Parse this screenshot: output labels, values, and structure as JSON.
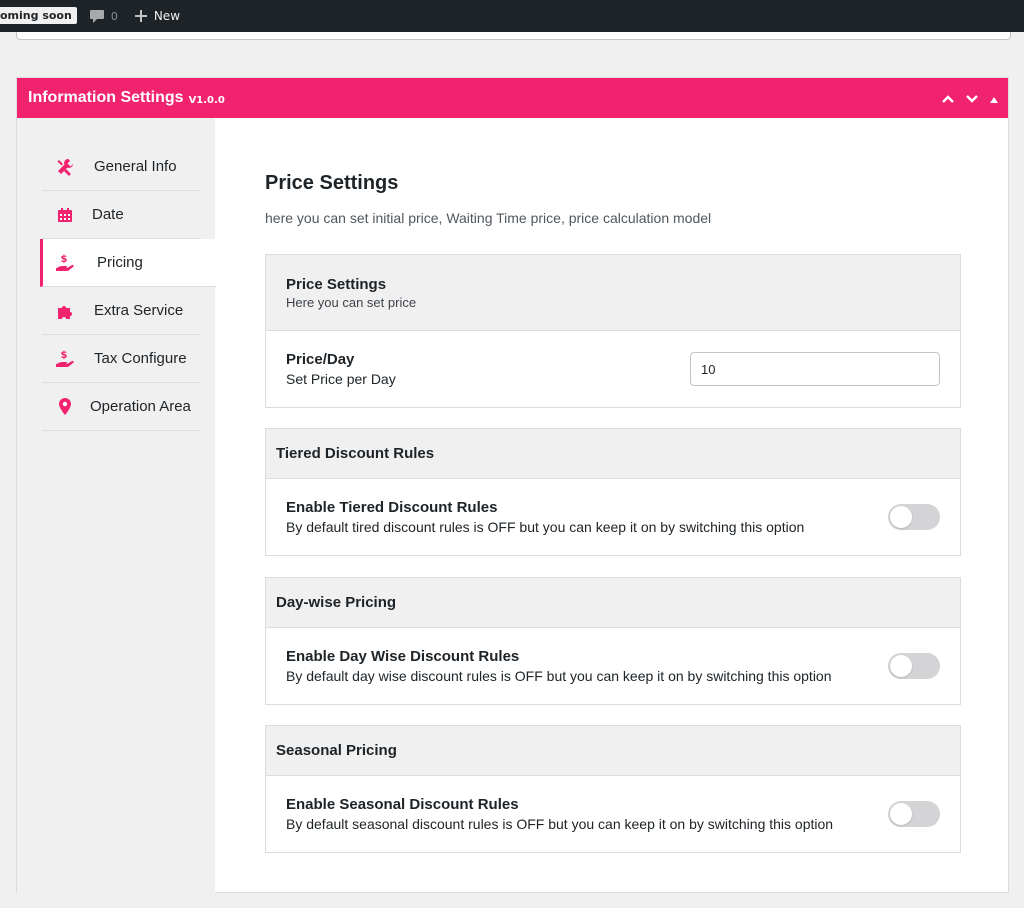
{
  "adminbar": {
    "site_label": "oming soon",
    "comments_count": "0",
    "new_label": "New"
  },
  "panel": {
    "title": "Information Settings",
    "version": "V1.0.0"
  },
  "sidebar": {
    "items": [
      {
        "label": "General Info",
        "icon": "tools-icon"
      },
      {
        "label": "Date",
        "icon": "calendar-icon"
      },
      {
        "label": "Pricing",
        "icon": "hand-dollar-icon",
        "active": true
      },
      {
        "label": "Extra Service",
        "icon": "puzzle-icon"
      },
      {
        "label": "Tax Configure",
        "icon": "hand-dollar-icon"
      },
      {
        "label": "Operation Area",
        "icon": "map-pin-icon"
      }
    ]
  },
  "main": {
    "heading": "Price Settings",
    "description": "here you can set initial price, Waiting Time price, price calculation model",
    "price_card": {
      "title": "Price Settings",
      "subtitle": "Here you can set price",
      "row_title": "Price/Day",
      "row_sub": "Set Price per Day",
      "value": "10"
    },
    "tiered": {
      "header": "Tiered Discount Rules",
      "title": "Enable Tiered Discount Rules",
      "sub": "By default tired discount rules is OFF but you can keep it on by switching this option",
      "enabled": false
    },
    "daywise": {
      "header": "Day-wise Pricing",
      "title": "Enable Day Wise Discount Rules",
      "sub": "By default day wise discount rules is OFF but you can keep it on by switching this option",
      "enabled": false
    },
    "seasonal": {
      "header": "Seasonal Pricing",
      "title": "Enable Seasonal Discount Rules",
      "sub": "By default seasonal discount rules is OFF but you can keep it on by switching this option",
      "enabled": false
    }
  },
  "colors": {
    "accent": "#f1236e",
    "adminbar": "#1d2327",
    "toggle_off": "#d4d4d6"
  }
}
